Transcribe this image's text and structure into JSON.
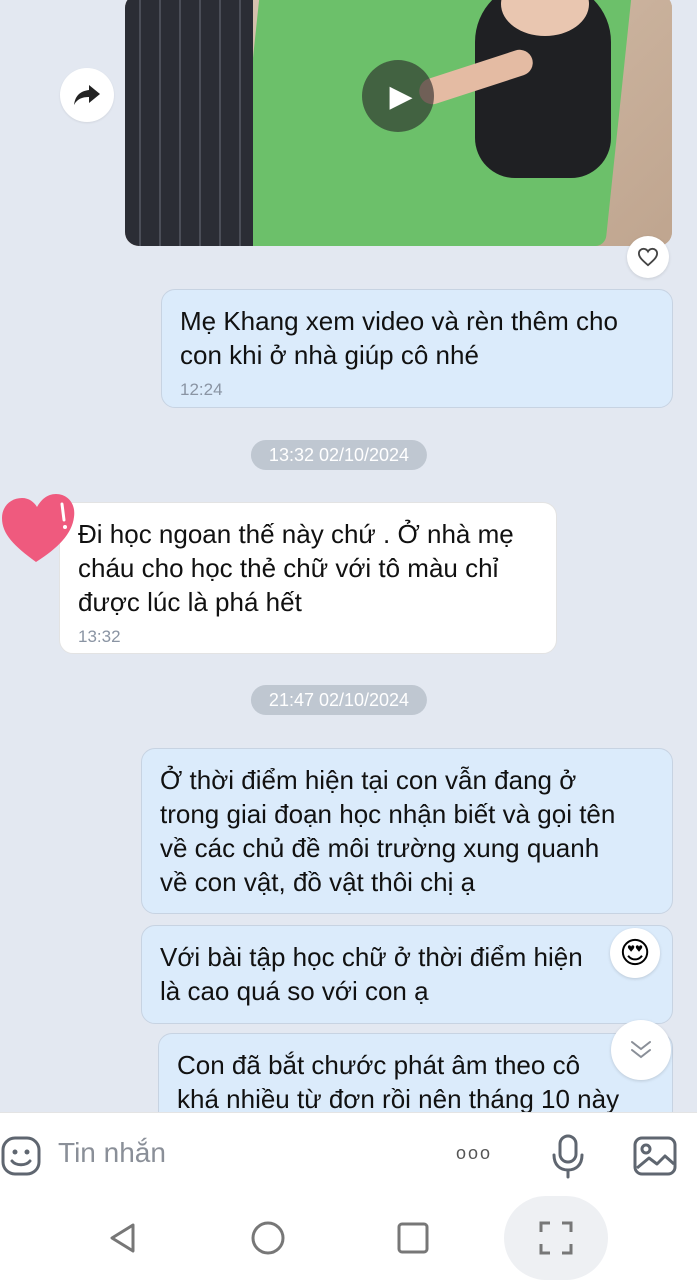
{
  "messages": {
    "m1": {
      "text": "Mẹ Khang xem video và rèn thêm cho\ncon khi ở nhà giúp cô nhé",
      "time": "12:24"
    },
    "date1": "13:32 02/10/2024",
    "m2": {
      "text": "Đi học ngoan thế này chứ . Ở nhà mẹ\ncháu cho học thẻ chữ với tô màu chỉ\nđược lúc là phá hết",
      "time": "13:32"
    },
    "date2": "21:47 02/10/2024",
    "m3": {
      "text": "Ở thời điểm hiện tại con vẫn đang ở\ntrong giai đoạn học nhận biết và gọi tên\nvề các chủ đề môi trường xung quanh\nvề con vật, đồ vật thôi chị ạ"
    },
    "m4": {
      "text": "Với bài tập học chữ ở thời điểm hiện\nlà cao quá so với con ạ"
    },
    "m5": {
      "text": "Con đã bắt chước phát âm theo cô\nkhá nhiều từ đơn rồi nên tháng 10 này"
    }
  },
  "reactions": {
    "m2": "heart",
    "m4": "😍"
  },
  "composer": {
    "placeholder": "Tin nhắn",
    "more_label": "ooo"
  },
  "icons": {
    "share": "share-arrow-icon",
    "like": "heart-outline-icon",
    "play": "play-icon",
    "sticker": "sticker-icon",
    "mic": "microphone-icon",
    "image": "image-icon",
    "back": "back-triangle-icon",
    "home": "home-circle-icon",
    "recents": "recents-square-icon",
    "expand": "expand-corners-icon"
  },
  "colors": {
    "outgoing_bubble": "#dbebfb",
    "incoming_bubble": "#ffffff",
    "background": "#e3e8f1",
    "date_chip": "#bfc7d1"
  }
}
